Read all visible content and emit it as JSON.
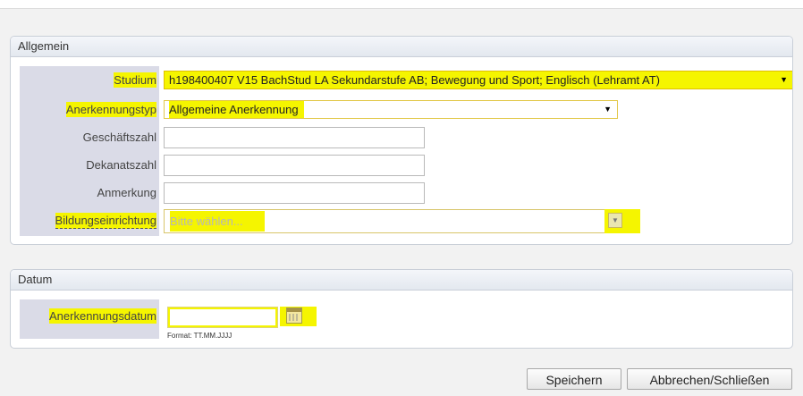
{
  "general": {
    "title": "Allgemein",
    "studium": {
      "label": "Studium",
      "value": "h198400407 V15 BachStud LA Sekundarstufe AB; Bewegung und Sport; Englisch (Lehramt AT)"
    },
    "anerkennungstyp": {
      "label": "Anerkennungstyp",
      "value": "Allgemeine Anerkennung"
    },
    "geschaeftszahl": {
      "label": "Geschäftszahl",
      "value": ""
    },
    "dekanatszahl": {
      "label": "Dekanatszahl",
      "value": ""
    },
    "anmerkung": {
      "label": "Anmerkung",
      "value": ""
    },
    "bildungseinrichtung": {
      "label": "Bildungseinrichtung",
      "placeholder": "Bitte wählen..."
    }
  },
  "date": {
    "title": "Datum",
    "anerkennungsdatum": {
      "label": "Anerkennungsdatum",
      "value": "",
      "format_hint": "Format: TT.MM.JJJJ",
      "calendar_icon": "calendar-icon"
    }
  },
  "buttons": {
    "save": "Speichern",
    "cancel": "Abbrechen/Schließen"
  },
  "colors": {
    "highlight": "#f5f500",
    "label_column": "#dadbe7",
    "panel_border": "#c9cfd8"
  }
}
